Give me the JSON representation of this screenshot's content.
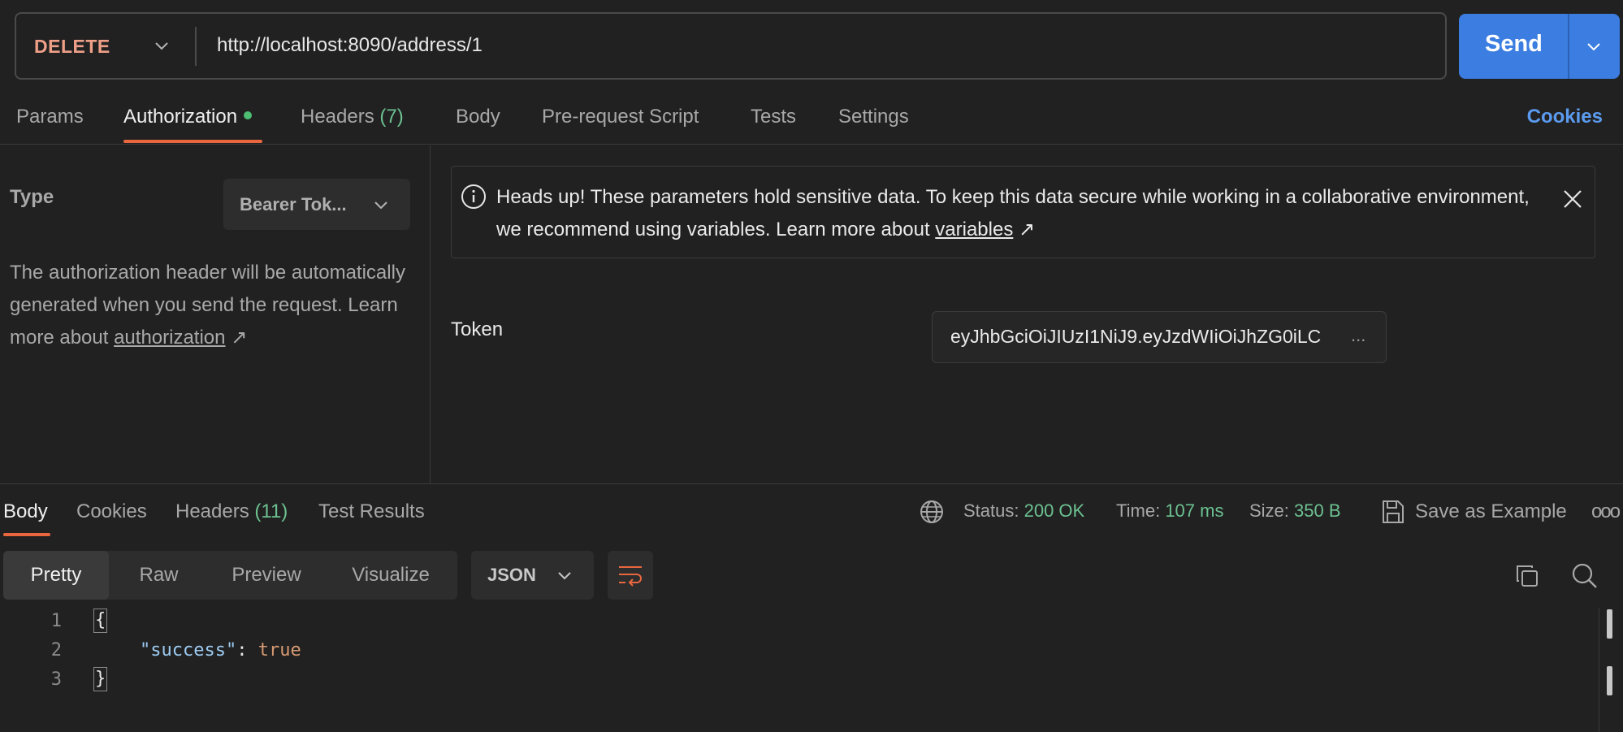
{
  "request": {
    "method": "DELETE",
    "url": "http://localhost:8090/address/1",
    "send_label": "Send"
  },
  "request_tabs": [
    {
      "label": "Params"
    },
    {
      "label": "Authorization"
    },
    {
      "label": "Headers",
      "count": "(7)"
    },
    {
      "label": "Body"
    },
    {
      "label": "Pre-request Script"
    },
    {
      "label": "Tests"
    },
    {
      "label": "Settings"
    }
  ],
  "cookies_link": "Cookies",
  "auth": {
    "type_label": "Type",
    "type_value": "Bearer Tok...",
    "description": "The authorization header will be automatically generated when you send the request. Learn more about ",
    "description_link": "authorization",
    "arrow": "↗"
  },
  "notice": {
    "text": "Heads up! These parameters hold sensitive data. To keep this data secure while working in a collaborative environment, we recommend using variables. Learn more about ",
    "link": "variables",
    "arrow": "↗"
  },
  "token": {
    "label": "Token",
    "value": "eyJhbGciOiJIUzI1NiJ9.eyJzdWIiOiJhZG0iLC",
    "ellipsis": "..."
  },
  "response_tabs": [
    {
      "label": "Body"
    },
    {
      "label": "Cookies"
    },
    {
      "label": "Headers",
      "count": "(11)"
    },
    {
      "label": "Test Results"
    }
  ],
  "response_meta": {
    "status_label": "Status:",
    "status_value": "200 OK",
    "time_label": "Time:",
    "time_value": "107 ms",
    "size_label": "Size:",
    "size_value": "350 B",
    "save_label": "Save as Example",
    "more": "ooo"
  },
  "view_modes": [
    "Pretty",
    "Raw",
    "Preview",
    "Visualize"
  ],
  "format": "JSON",
  "code_lines": {
    "numbers": [
      "1",
      "2",
      "3"
    ],
    "open_brace": "{",
    "key": "\"success\"",
    "colon": ": ",
    "value": "true",
    "close_brace": "}"
  },
  "colors": {
    "method": "#ef9f87",
    "send": "#3b7de0",
    "accent_underline": "#e9673e",
    "status_green": "#6cc191",
    "link_blue": "#5b9bef"
  }
}
